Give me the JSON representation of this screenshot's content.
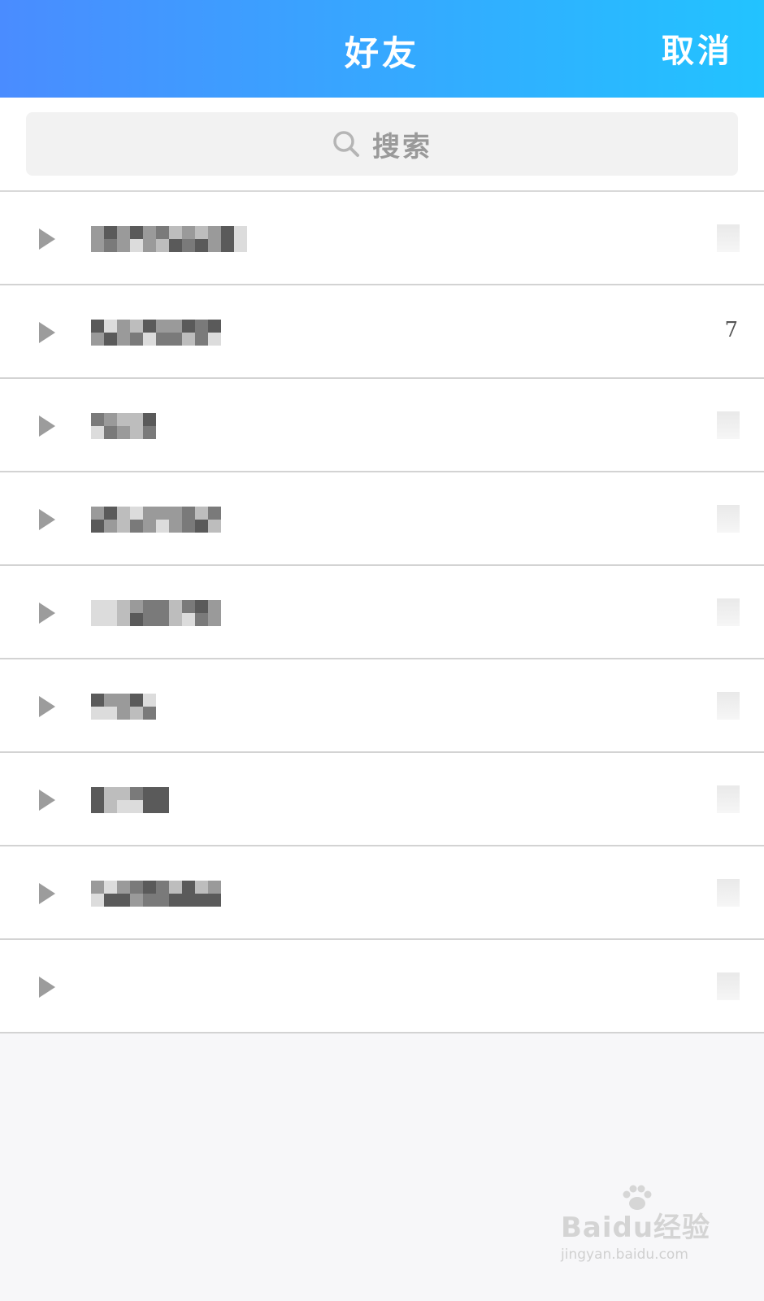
{
  "header": {
    "title": "好友",
    "cancel_label": "取消",
    "gradient_start": "#4a8cff",
    "gradient_end": "#22c3ff"
  },
  "search": {
    "placeholder": "搜索",
    "icon": "search-icon"
  },
  "groups": [
    {
      "count": ""
    },
    {
      "count": "7"
    },
    {
      "count": ""
    },
    {
      "count": ""
    },
    {
      "count": ""
    },
    {
      "count": ""
    },
    {
      "count": ""
    },
    {
      "count": ""
    },
    {
      "count": ""
    }
  ],
  "watermark": {
    "brand": "Baidu经验",
    "url": "jingyan.baidu.com"
  }
}
